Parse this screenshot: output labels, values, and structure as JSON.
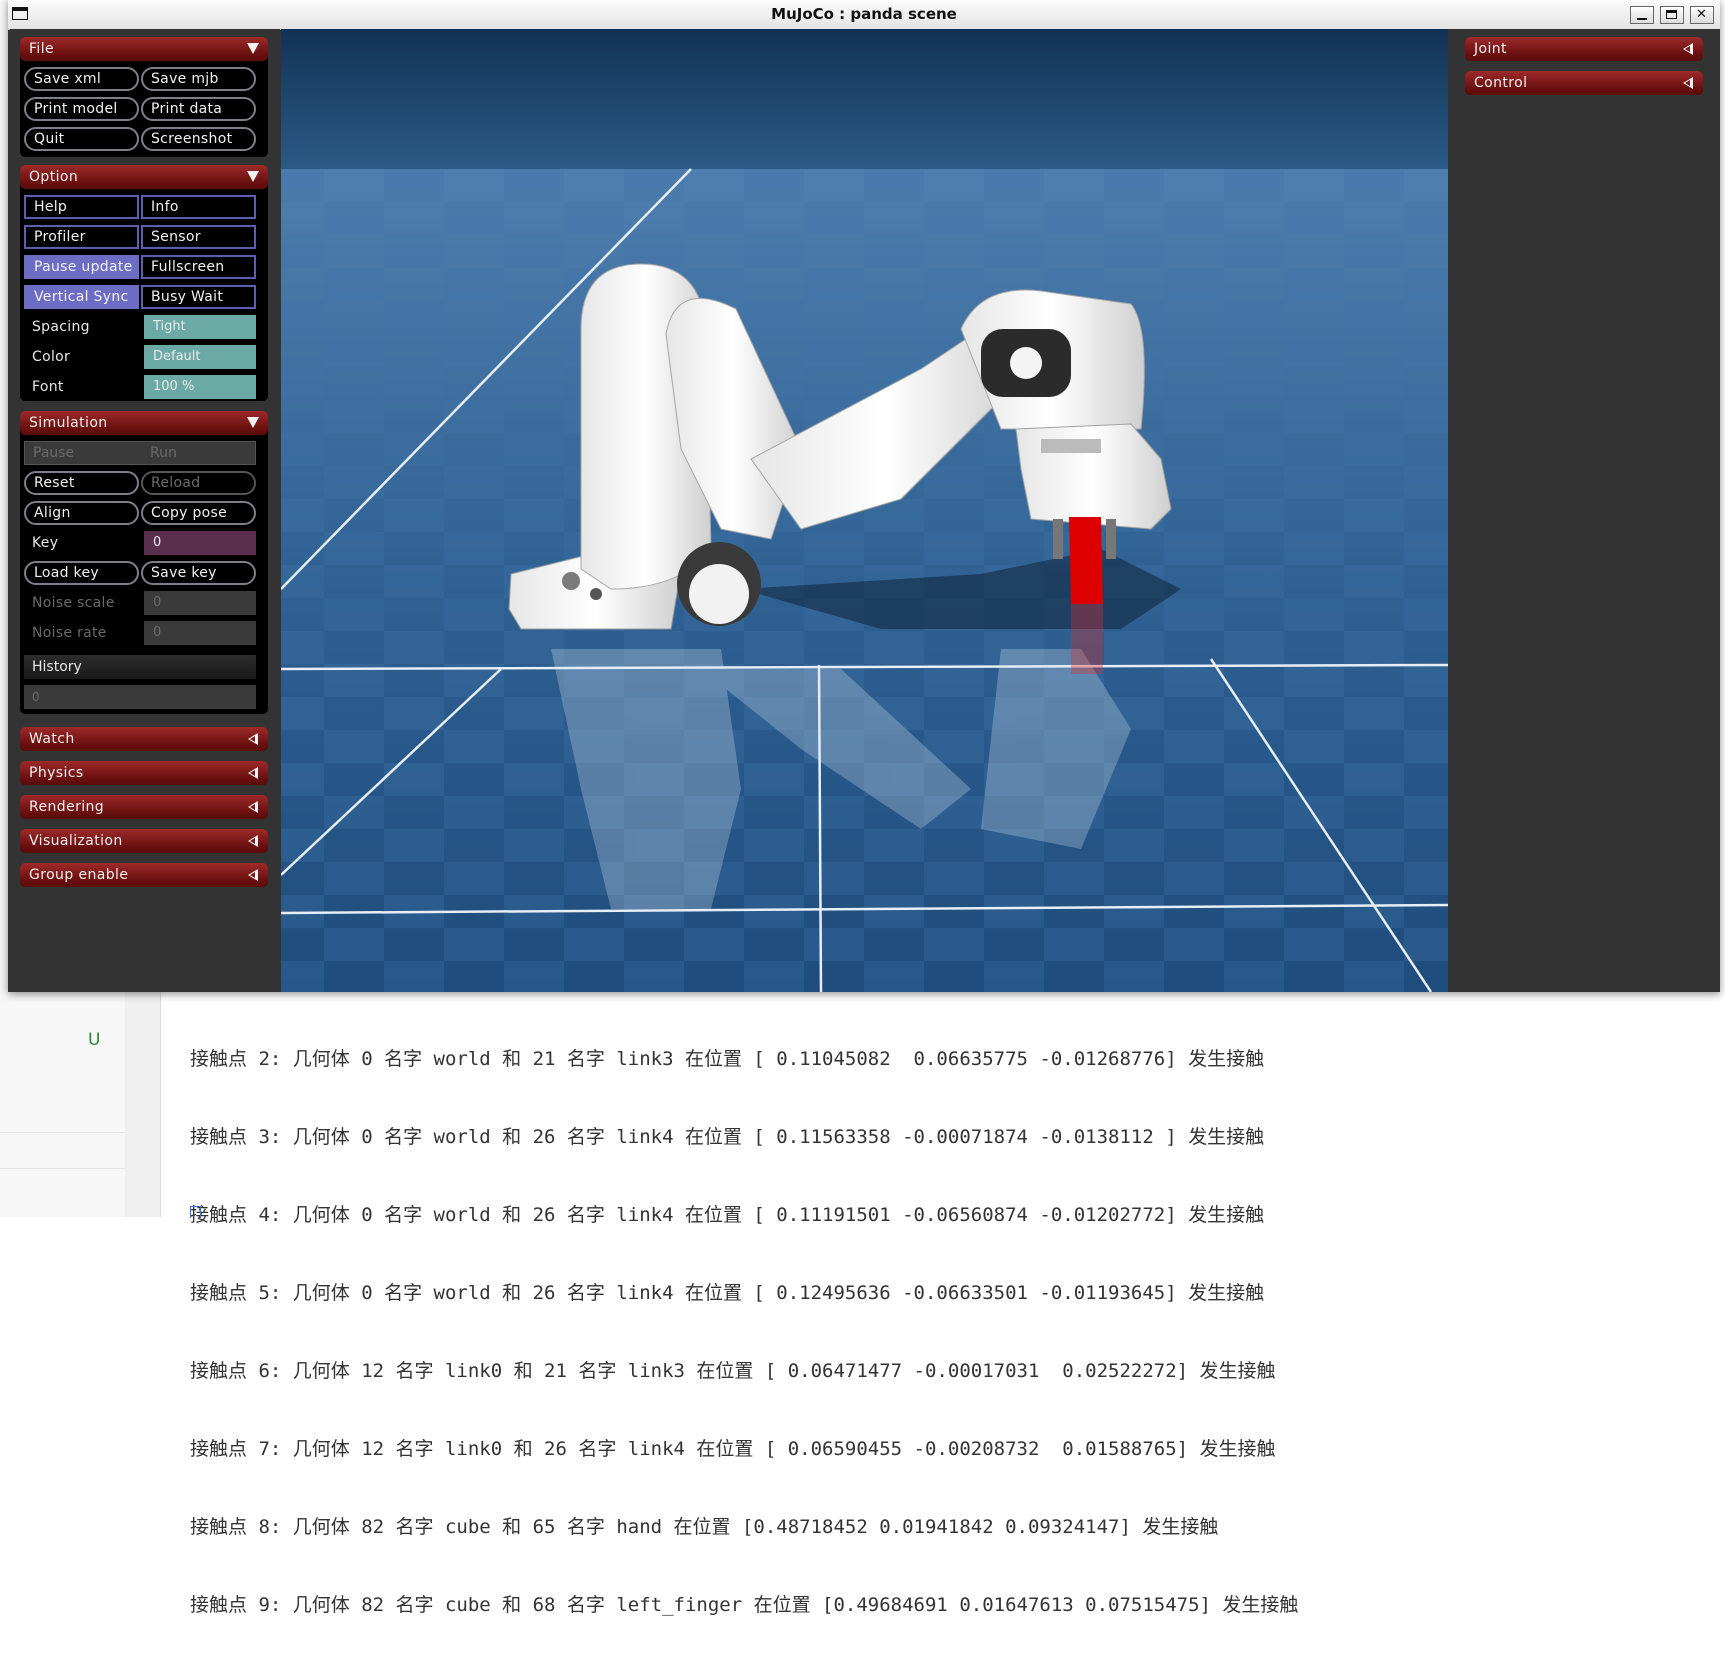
{
  "window": {
    "title": "MuJoCo : panda scene"
  },
  "left_panel": {
    "file": {
      "title": "File",
      "buttons": [
        "Save xml",
        "Save mjb",
        "Print model",
        "Print data",
        "Quit",
        "Screenshot"
      ]
    },
    "option": {
      "title": "Option",
      "toggles": [
        {
          "label": "Help",
          "on": false
        },
        {
          "label": "Info",
          "on": false
        },
        {
          "label": "Profiler",
          "on": false
        },
        {
          "label": "Sensor",
          "on": false
        },
        {
          "label": "Pause update",
          "on": true
        },
        {
          "label": "Fullscreen",
          "on": false
        },
        {
          "label": "Vertical Sync",
          "on": true
        },
        {
          "label": "Busy Wait",
          "on": false
        }
      ],
      "spacing": {
        "label": "Spacing",
        "value": "Tight"
      },
      "color": {
        "label": "Color",
        "value": "Default"
      },
      "font": {
        "label": "Font",
        "value": "100 %"
      }
    },
    "simulation": {
      "title": "Simulation",
      "pause": "Pause",
      "run": "Run",
      "reset": "Reset",
      "reload": "Reload",
      "align": "Align",
      "copy_pose": "Copy pose",
      "key": {
        "label": "Key",
        "value": "0"
      },
      "load_key": "Load key",
      "save_key": "Save key",
      "noise_scale": {
        "label": "Noise scale",
        "value": "0"
      },
      "noise_rate": {
        "label": "Noise rate",
        "value": "0"
      },
      "history": {
        "label": "History",
        "value": "0"
      }
    },
    "collapsed": [
      "Watch",
      "Physics",
      "Rendering",
      "Visualization",
      "Group enable"
    ]
  },
  "right_panel": {
    "sections": [
      "Joint",
      "Control"
    ]
  },
  "background_ide": {
    "gutter_marker": "U",
    "console_lines": [
      "接触点 2: 几何体 0 名字 world 和 21 名字 link3 在位置 [ 0.11045082  0.06635775 -0.01268776] 发生接触",
      "接触点 3: 几何体 0 名字 world 和 26 名字 link4 在位置 [ 0.11563358 -0.00071874 -0.0138112 ] 发生接触",
      "接触点 4: 几何体 0 名字 world 和 26 名字 link4 在位置 [ 0.11191501 -0.06560874 -0.01202772] 发生接触",
      "接触点 5: 几何体 0 名字 world 和 26 名字 link4 在位置 [ 0.12495636 -0.06633501 -0.01193645] 发生接触",
      "接触点 6: 几何体 12 名字 link0 和 21 名字 link3 在位置 [ 0.06471477 -0.00017031  0.02522272] 发生接触",
      "接触点 7: 几何体 12 名字 link0 和 26 名字 link4 在位置 [ 0.06590455 -0.00208732  0.01588765] 发生接触",
      "接触点 8: 几何体 82 名字 cube 和 65 名字 hand 在位置 [0.48718452 0.01941842 0.09324147] 发生接触",
      "接触点 9: 几何体 82 名字 cube 和 68 名字 left_finger 在位置 [0.49684691 0.01647613 0.07515475] 发生接触"
    ]
  },
  "colors": {
    "panel_bg": "#333333",
    "section_header_red": "#8b1f1f",
    "toggle_on": "#6c6cc4",
    "teal_value": "#6aa9a4",
    "floor_blue": "#2f5f8e",
    "cube_red": "#dd0000"
  },
  "icons": [
    "window-menu-icon",
    "minimize-icon",
    "maximize-icon",
    "close-icon",
    "expand-triangle-icon",
    "collapse-triangle-icon"
  ]
}
